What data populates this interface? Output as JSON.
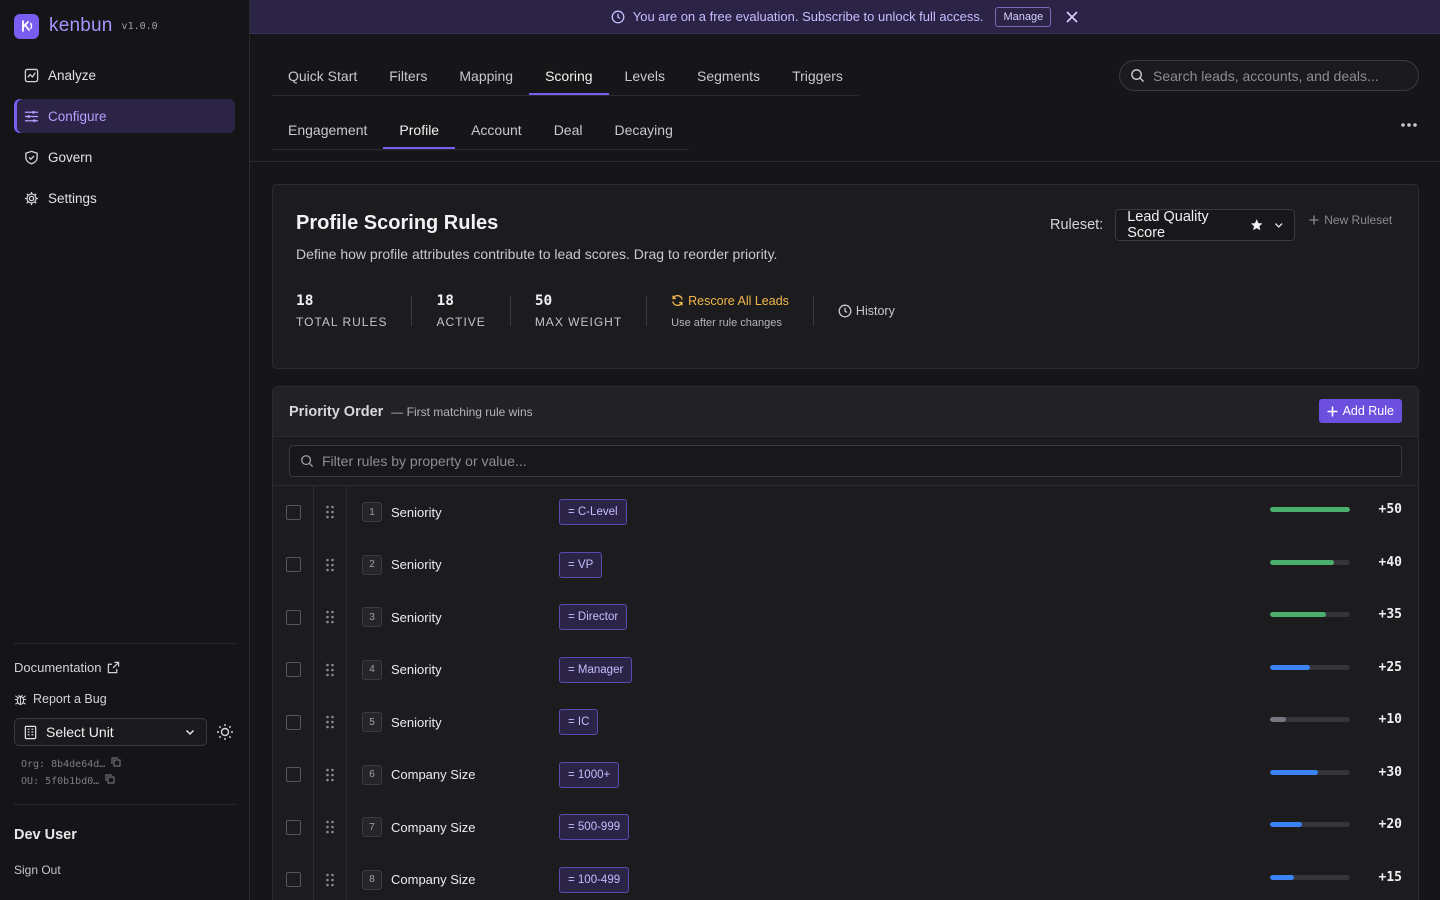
{
  "brand": {
    "name": "kenbun",
    "version": "v1.0.0"
  },
  "sidebar": {
    "items": [
      {
        "label": "Analyze",
        "icon": "chart-square-icon",
        "active": false
      },
      {
        "label": "Configure",
        "icon": "sliders-icon",
        "active": true
      },
      {
        "label": "Govern",
        "icon": "shield-icon",
        "active": false
      },
      {
        "label": "Settings",
        "icon": "gear-icon",
        "active": false
      }
    ],
    "documentation": "Documentation",
    "report_bug": "Report a Bug",
    "unit_select": "Select Unit",
    "org_id": "Org: 8b4de64d…",
    "ou_id": "OU: 5f0b1bd0…",
    "user_name": "Dev User",
    "sign_out": "Sign Out"
  },
  "banner": {
    "message": "You are on a free evaluation. Subscribe to unlock full access.",
    "manage": "Manage"
  },
  "tabs_primary": [
    "Quick Start",
    "Filters",
    "Mapping",
    "Scoring",
    "Levels",
    "Segments",
    "Triggers"
  ],
  "tabs_primary_active": "Scoring",
  "tabs_secondary": [
    "Engagement",
    "Profile",
    "Account",
    "Deal",
    "Decaying"
  ],
  "tabs_secondary_active": "Profile",
  "search": {
    "placeholder": "Search leads, accounts, and deals..."
  },
  "card": {
    "title": "Profile Scoring Rules",
    "description": "Define how profile attributes contribute to lead scores. Drag to reorder priority.",
    "ruleset_label": "Ruleset:",
    "ruleset_value": "Lead Quality Score",
    "new_ruleset": "New Ruleset",
    "stats": [
      {
        "num": "18",
        "label": "TOTAL RULES"
      },
      {
        "num": "18",
        "label": "ACTIVE"
      },
      {
        "num": "50",
        "label": "MAX WEIGHT"
      }
    ],
    "rescore": "Rescore All Leads",
    "rescore_sub": "Use after rule changes",
    "history": "History"
  },
  "priority": {
    "title": "Priority Order",
    "subtitle": "— First matching rule wins",
    "add_rule": "Add Rule",
    "filter_placeholder": "Filter rules by property or value..."
  },
  "colors": {
    "green": "#4caf6e",
    "blue": "#3b82f6",
    "gray": "#77777f",
    "accent": "#7b5cf0",
    "warning": "#f1b84a"
  },
  "rules": [
    {
      "n": "1",
      "prop": "Seniority",
      "val": "= C-Level",
      "weight": "+50",
      "fraction": 1.0,
      "color": "green"
    },
    {
      "n": "2",
      "prop": "Seniority",
      "val": "= VP",
      "weight": "+40",
      "fraction": 0.8,
      "color": "green"
    },
    {
      "n": "3",
      "prop": "Seniority",
      "val": "= Director",
      "weight": "+35",
      "fraction": 0.7,
      "color": "green"
    },
    {
      "n": "4",
      "prop": "Seniority",
      "val": "= Manager",
      "weight": "+25",
      "fraction": 0.5,
      "color": "blue"
    },
    {
      "n": "5",
      "prop": "Seniority",
      "val": "= IC",
      "weight": "+10",
      "fraction": 0.2,
      "color": "gray"
    },
    {
      "n": "6",
      "prop": "Company Size",
      "val": "= 1000+",
      "weight": "+30",
      "fraction": 0.6,
      "color": "blue"
    },
    {
      "n": "7",
      "prop": "Company Size",
      "val": "= 500-999",
      "weight": "+20",
      "fraction": 0.4,
      "color": "blue"
    },
    {
      "n": "8",
      "prop": "Company Size",
      "val": "= 100-499",
      "weight": "+15",
      "fraction": 0.3,
      "color": "blue"
    }
  ]
}
